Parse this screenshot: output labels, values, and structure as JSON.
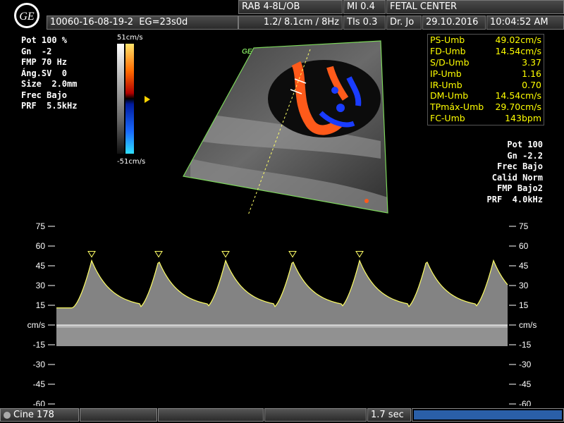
{
  "header": {
    "probe": "RAB 4-8L/OB",
    "mi": "MI  0.4",
    "center": "FETAL CENTER",
    "patient_id": "10060-16-08-19-2",
    "ga": "EG=23s0d",
    "depth": "1.2/ 8.1cm / 8Hz",
    "tis": "TIs  0.3",
    "doctor": "Dr. Jo",
    "date": "29.10.2016",
    "time": "10:04:52 AM"
  },
  "left_params": [
    "Pot 100 %",
    "Gn  -2",
    "FMP 70 Hz",
    "Áng.SV  0",
    "Size  2.0mm",
    "Frec Bajo",
    "PRF  5.5kHz"
  ],
  "colorbar": {
    "top": "51cm/s",
    "bottom": "-51cm/s"
  },
  "ge_mark": "GE",
  "measurements": [
    {
      "label": "PS-Umb",
      "value": "49.02cm/s"
    },
    {
      "label": "FD-Umb",
      "value": "14.54cm/s"
    },
    {
      "label": "S/D-Umb",
      "value": "3.37"
    },
    {
      "label": "IP-Umb",
      "value": "1.16"
    },
    {
      "label": "IR-Umb",
      "value": "0.70"
    },
    {
      "label": "DM-Umb",
      "value": "14.54cm/s"
    },
    {
      "label": "TPmáx-Umb",
      "value": "29.70cm/s"
    },
    {
      "label": "FC-Umb",
      "value": "143bpm"
    }
  ],
  "right_params": [
    "Pot 100",
    "Gn -2.2",
    "Frec Bajo",
    "Calid Norm",
    "FMP Bajo2",
    "PRF  4.0kHz"
  ],
  "doppler": {
    "unit": "cm/s",
    "ticks": [
      "75",
      "60",
      "45",
      "30",
      "15",
      "cm/s",
      "-15",
      "-30",
      "-45",
      "-60"
    ],
    "tick_values": [
      75,
      60,
      45,
      30,
      15,
      0,
      -15,
      -30,
      -45,
      -60
    ]
  },
  "footer": {
    "cine": "Cine 178",
    "sweep": "1.7 sec"
  },
  "colors": {
    "measure_text": "#ffff00",
    "trace": "#ffff66",
    "flow_red": "#ff5a1a",
    "flow_blue": "#1a3cff",
    "sector_outline": "#7cd65a"
  }
}
